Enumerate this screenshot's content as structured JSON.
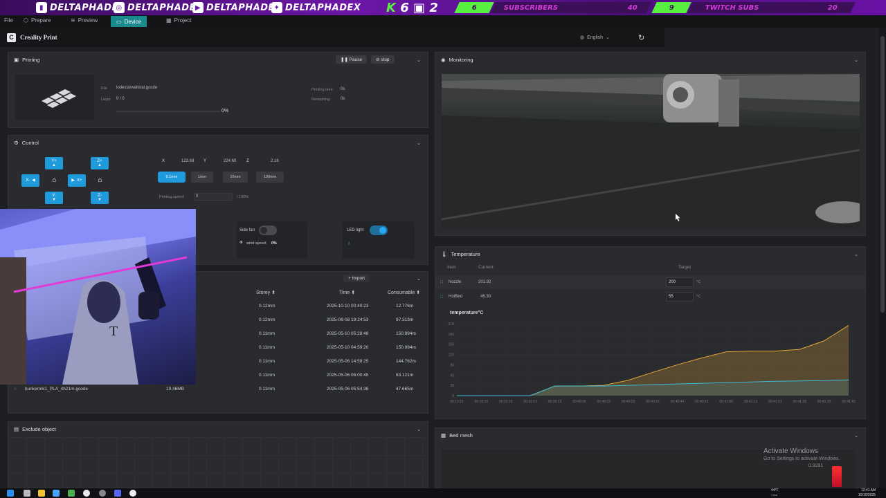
{
  "banner": {
    "socials": [
      {
        "icon": "twitch-icon",
        "handle": "DELTAPHADE"
      },
      {
        "icon": "instagram-icon",
        "handle": "DELTAPHADE"
      },
      {
        "icon": "youtube-icon",
        "handle": "DELTAPHADE"
      },
      {
        "icon": "twitter-icon",
        "handle": "DELTAPHADEX"
      }
    ],
    "brand_k": "K",
    "brand_6": "6",
    "brand_2": "2",
    "subs_current": "6",
    "subs_label": "SUBSCRIBERS",
    "subs_goal": "40",
    "twitch_current": "9",
    "twitch_label": "TWITCH SUBS",
    "twitch_goal": "20"
  },
  "app_tabs": {
    "file": "File",
    "prepare": "Prepare",
    "preview": "Preview",
    "device": "Device",
    "project": "Project"
  },
  "header": {
    "app_name": "Creality Print",
    "language": "English"
  },
  "printing": {
    "title": "Printing",
    "pause_label": "Pause",
    "stop_label": "stop",
    "file_label": "File",
    "file_value": "lodestarwallstal.gcode",
    "layer_label": "Layer",
    "layer_value": "0 / 0",
    "progress": "0%",
    "progress_fraction": 0.0,
    "printing_time_label": "Printing time:",
    "printing_time_value": "0s",
    "remaining_label": "Remaining:",
    "remaining_value": "0s"
  },
  "control": {
    "title": "Control",
    "y_plus": "Y+",
    "z_plus": "Z+",
    "x_minus": "X-",
    "x_plus": "X+",
    "y_minus": "Y-",
    "z_minus": "Z-",
    "x_label": "X",
    "x_value": "123.68",
    "y_label": "Y",
    "y_value": "224.60",
    "z_label": "Z",
    "z_value": "2.16",
    "steps": [
      "0.1mm",
      "1mm",
      "10mm",
      "100mm"
    ],
    "speed_label": "Printing speed:",
    "speed_value": "0",
    "speed_max": "/ 100%",
    "side_fan_label": "Side fan",
    "wind_speed_label": "wind speed:",
    "wind_speed_value": "0%",
    "led_label": "LED light"
  },
  "files": {
    "import_label": "Import",
    "headers": {
      "storey": "Storey",
      "time": "Time",
      "consumable": "Consumable"
    },
    "rows": [
      {
        "name": "",
        "size": "",
        "storey": "0.12mm",
        "time": "2025-10-10 00:40:23",
        "consumable": "12.776m"
      },
      {
        "name": "",
        "size": "",
        "storey": "0.12mm",
        "time": "2025-06-08 19:24:53",
        "consumable": "97.313m"
      },
      {
        "name": "",
        "size": "",
        "storey": "0.11mm",
        "time": "2025-05-10 05:28:48",
        "consumable": "150.994m"
      },
      {
        "name": "",
        "size": "",
        "storey": "0.11mm",
        "time": "2025-05-10 04:59:20",
        "consumable": "150.994m"
      },
      {
        "name": "",
        "size": "",
        "storey": "0.11mm",
        "time": "2025-05-06 14:58:25",
        "consumable": "144.762m"
      },
      {
        "name": "",
        "size": "",
        "storey": "0.11mm",
        "time": "2025-05-06 06:00:45",
        "consumable": "63.121m"
      },
      {
        "name": "bunkermk1_PLA_4h21m.gcode",
        "size": "19.46MB",
        "storey": "0.11mm",
        "time": "2025-05-06 05:54:36",
        "consumable": "47.665m"
      }
    ]
  },
  "exclude": {
    "title": "Exclude object"
  },
  "monitoring": {
    "title": "Monitoring"
  },
  "temperature": {
    "title": "Temperature",
    "item_header": "Item",
    "current_header": "Current",
    "target_header": "Target",
    "nozzle_label": "Nozzle",
    "nozzle_current": "201.92",
    "nozzle_target": "200",
    "hotbed_label": "HotBed",
    "hotbed_current": "46.30",
    "hotbed_target": "55",
    "unit": "°C"
  },
  "chart_data": {
    "type": "line",
    "title": "temperature°C",
    "ylim": [
      0,
      210
    ],
    "y_ticks": [
      "210",
      "180",
      "150",
      "120",
      "90",
      "60",
      "30",
      "0"
    ],
    "x": [
      "00:13:15",
      "00:18:15",
      "00:23:15",
      "00:32:13",
      "00:39:13",
      "00:40:05",
      "00:40:22",
      "00:40:20",
      "00:40:37",
      "00:40:44",
      "00:40:51",
      "00:41:00",
      "00:41:11",
      "00:41:21",
      "00:41:28",
      "00:41:35",
      "00:41:42"
    ],
    "series": [
      {
        "name": "",
        "color": "#e3a93a",
        "values": [
          0,
          0,
          0,
          0,
          28,
          28,
          30,
          45,
          68,
          90,
          110,
          128,
          130,
          130,
          135,
          160,
          205
        ]
      },
      {
        "name": "",
        "color": "#3fb8d8",
        "values": [
          0,
          0,
          0,
          0,
          28,
          28,
          28,
          30,
          32,
          34,
          36,
          38,
          40,
          42,
          43,
          44,
          46
        ]
      }
    ],
    "grid": true
  },
  "bed_mesh": {
    "title": "Bed mesh",
    "value": "0.9281"
  },
  "watermark": {
    "line1": "Activate Windows",
    "line2": "Go to Settings to activate Windows."
  },
  "taskbar": {
    "weather": "44°F",
    "weather_sub": "Clear",
    "clock": "12:41 AM",
    "date": "10/10/2025"
  }
}
